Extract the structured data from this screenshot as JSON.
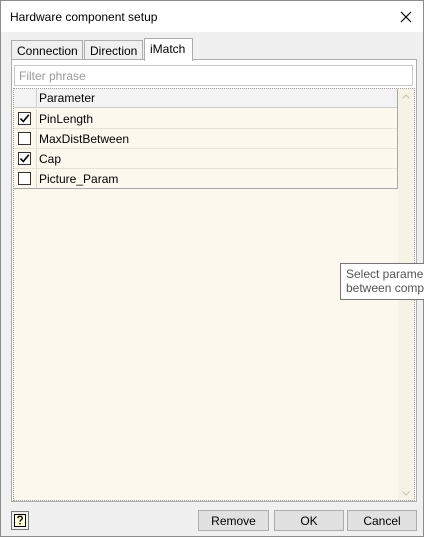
{
  "window": {
    "title": "Hardware component setup",
    "close_icon": "close-icon"
  },
  "tabs": [
    {
      "label": "Connection",
      "active": false
    },
    {
      "label": "Direction",
      "active": false
    },
    {
      "label": "iMatch",
      "active": true
    }
  ],
  "filter": {
    "placeholder": "Filter phrase",
    "value": ""
  },
  "grid": {
    "columns": [
      "Parameter"
    ],
    "rows": [
      {
        "checked": true,
        "parameter": "PinLength"
      },
      {
        "checked": false,
        "parameter": "MaxDistBetween"
      },
      {
        "checked": true,
        "parameter": "Cap"
      },
      {
        "checked": false,
        "parameter": "Picture_Param"
      }
    ]
  },
  "tooltip": {
    "line1": "Select parame",
    "line2": "between comp"
  },
  "buttons": {
    "help_icon": "help-icon",
    "remove": "Remove",
    "ok": "OK",
    "cancel": "Cancel"
  },
  "colors": {
    "grid_background": "#fdf8ee",
    "window_background": "#f0f0f0"
  }
}
